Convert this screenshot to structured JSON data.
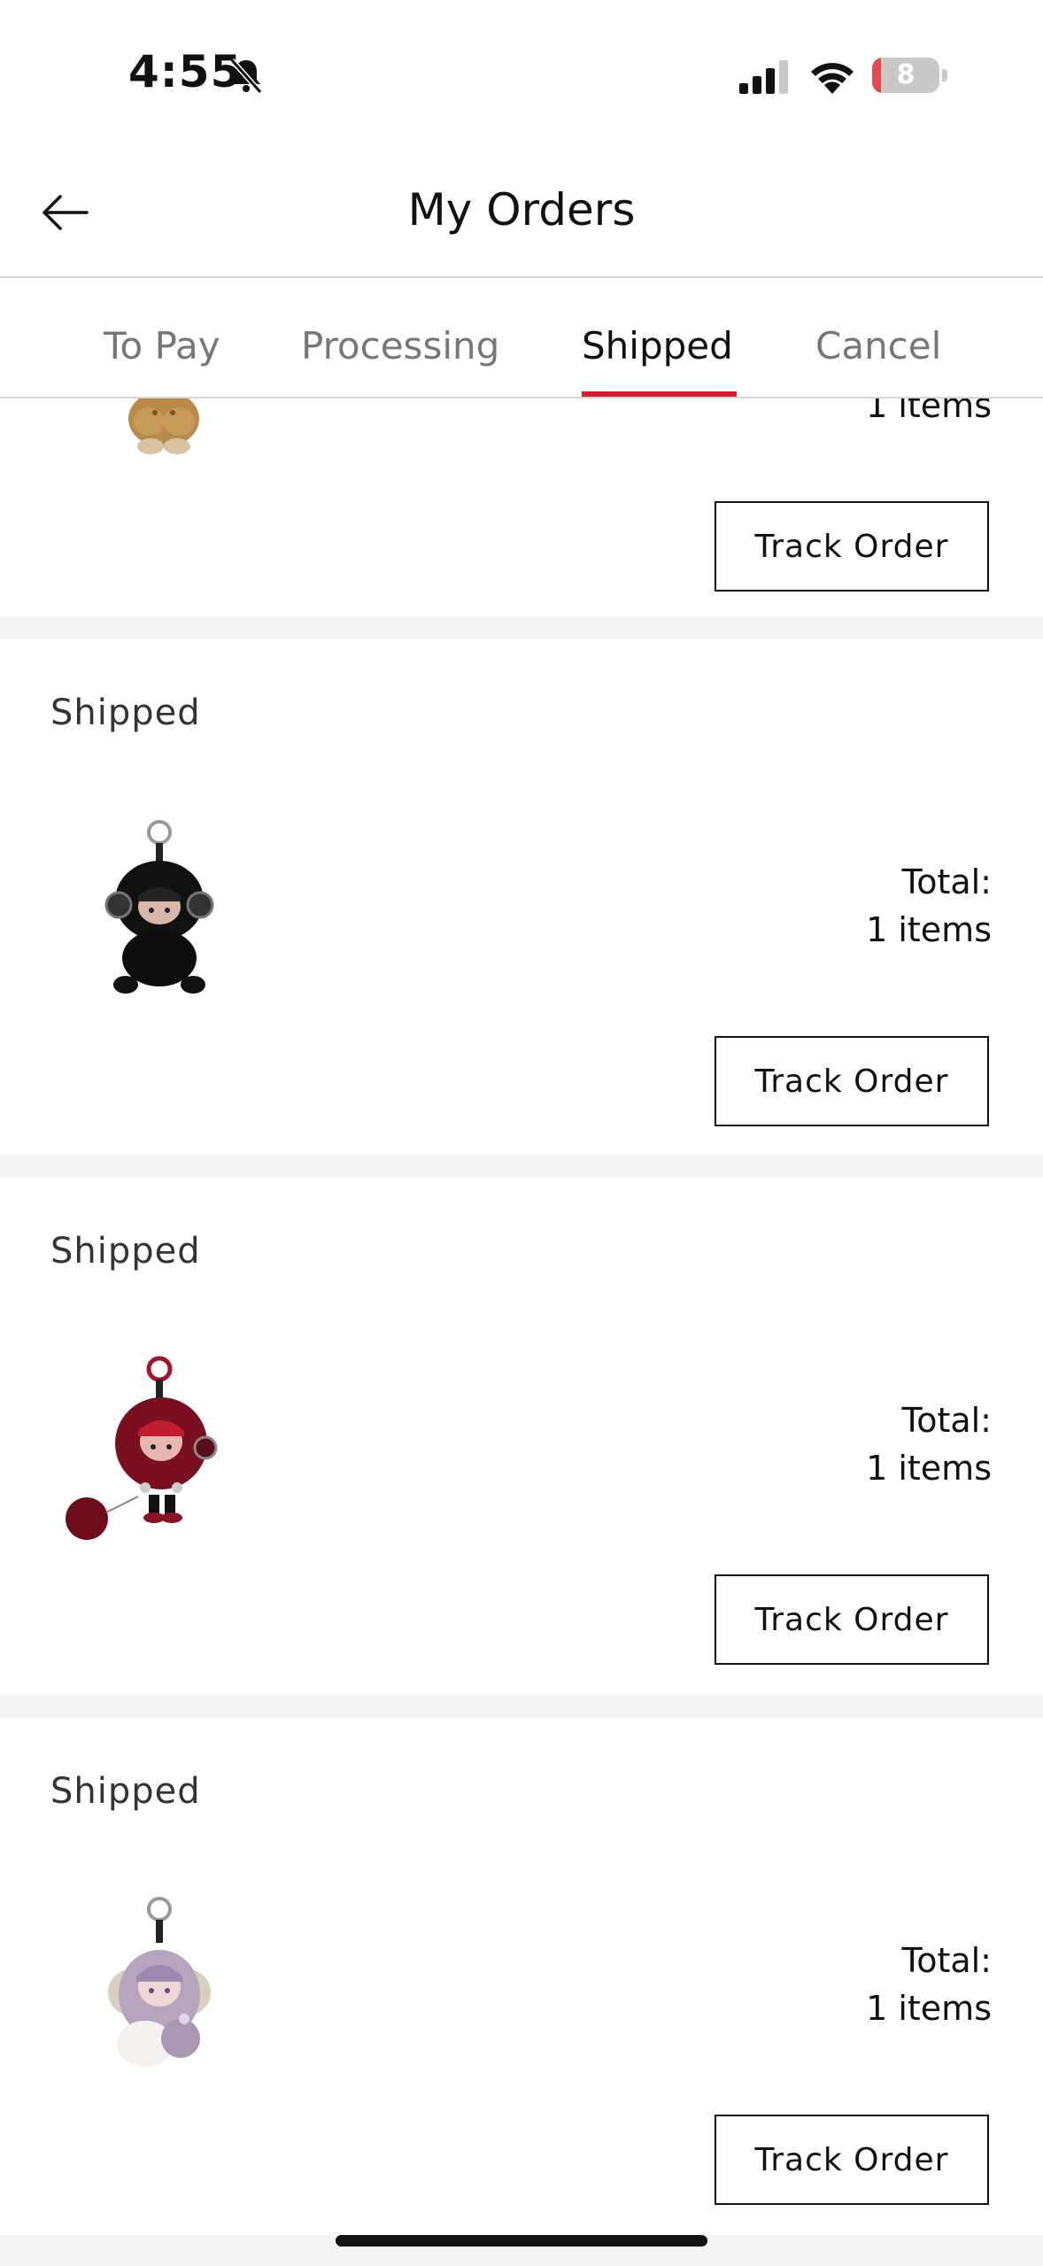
{
  "status_bar": {
    "time": "4:55",
    "battery_level": "8",
    "icons": [
      "bell-slash-icon",
      "cellular-signal-icon",
      "wifi-icon",
      "battery-icon"
    ]
  },
  "header": {
    "title": "My Orders",
    "back_icon": "arrow-left-icon"
  },
  "tabs": [
    {
      "label": "To Pay",
      "active": false
    },
    {
      "label": "Processing",
      "active": false
    },
    {
      "label": "Shipped",
      "active": true
    },
    {
      "label": "Cancel",
      "active": false
    }
  ],
  "colors": {
    "accent": "#d81e2c",
    "background": "#f5f5f5",
    "card": "#ffffff"
  },
  "orders": [
    {
      "status": "",
      "items_count": "1 items",
      "track_label": "Track Order",
      "product_thumb": "brown-plush-figure"
    },
    {
      "status": "Shipped",
      "total_label": "Total:",
      "items_count": "1 items",
      "track_label": "Track Order",
      "product_thumb": "black-plush-figure-keychain"
    },
    {
      "status": "Shipped",
      "total_label": "Total:",
      "items_count": "1 items",
      "track_label": "Track Order",
      "product_thumb": "red-plush-figure-keychain"
    },
    {
      "status": "Shipped",
      "total_label": "Total:",
      "items_count": "1 items",
      "track_label": "Track Order",
      "product_thumb": "lavender-plush-figure-keychain"
    }
  ]
}
